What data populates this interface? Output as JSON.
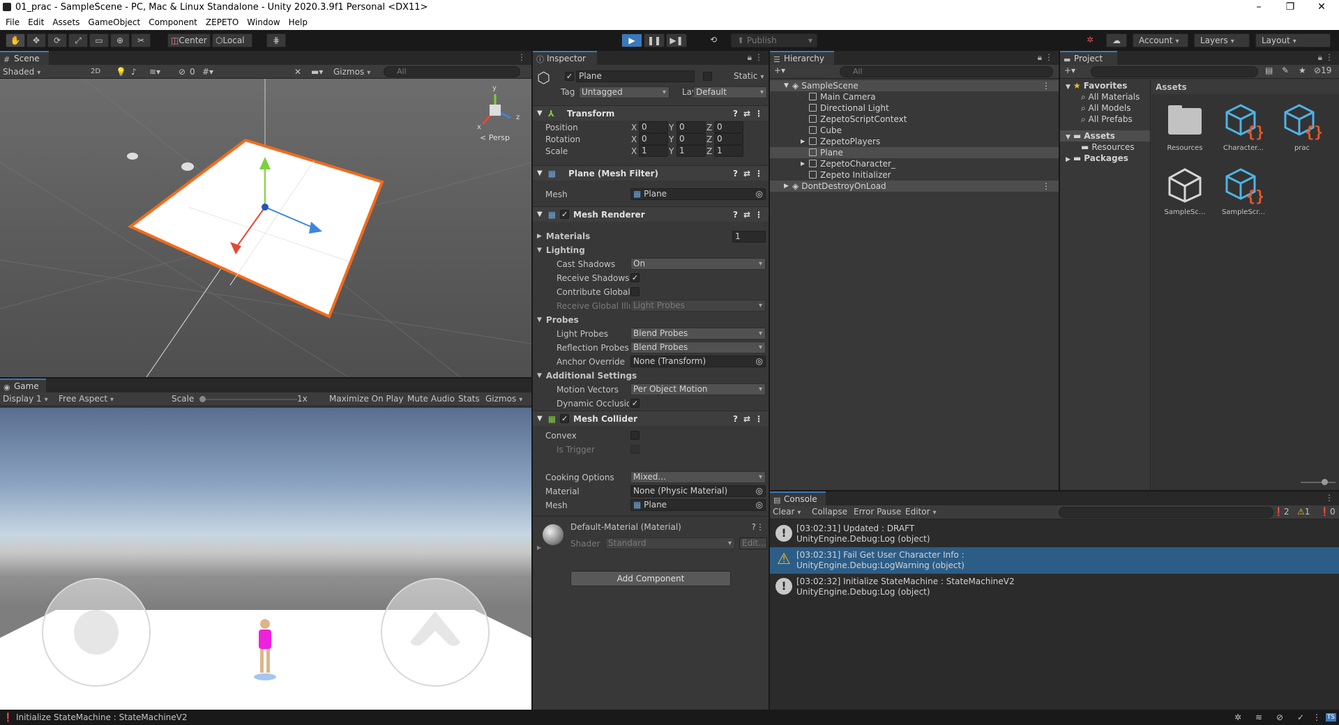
{
  "window": {
    "title": "01_prac - SampleScene - PC, Mac & Linux Standalone - Unity 2020.3.9f1 Personal <DX11>",
    "minimize": "–",
    "maximize": "❐",
    "close": "✕"
  },
  "menu": [
    "File",
    "Edit",
    "Assets",
    "GameObject",
    "Component",
    "ZEPETO",
    "Window",
    "Help"
  ],
  "toolbar": {
    "pivot": "Center",
    "space": "Local",
    "publish": "Publish",
    "account": "Account",
    "layers": "Layers",
    "layout": "Layout"
  },
  "scene": {
    "tab": "Scene",
    "shading": "Shaded",
    "mode2d": "2D",
    "hidden_count": "0",
    "gizmos": "Gizmos",
    "search_placeholder": "All",
    "persp": "Persp",
    "axis_y": "y",
    "axis_x": "x",
    "axis_z": "z"
  },
  "game": {
    "tab": "Game",
    "display": "Display 1",
    "aspect": "Free Aspect",
    "scale_label": "Scale",
    "scale_value": "1x",
    "maximize": "Maximize On Play",
    "mute": "Mute Audio",
    "stats": "Stats",
    "gizmos": "Gizmos"
  },
  "inspector": {
    "tab": "Inspector",
    "object_name": "Plane",
    "static": "Static",
    "tag_label": "Tag",
    "tag": "Untagged",
    "layer_label": "Layer",
    "layer": "Default",
    "transform": {
      "title": "Transform",
      "rows": [
        {
          "label": "Position",
          "x": "0",
          "y": "0",
          "z": "0"
        },
        {
          "label": "Rotation",
          "x": "0",
          "y": "0",
          "z": "0"
        },
        {
          "label": "Scale",
          "x": "1",
          "y": "1",
          "z": "1"
        }
      ]
    },
    "mesh_filter": {
      "title": "Plane (Mesh Filter)",
      "mesh_label": "Mesh",
      "mesh": "Plane"
    },
    "mesh_renderer": {
      "title": "Mesh Renderer",
      "materials_label": "Materials",
      "materials_count": "1",
      "lighting": "Lighting",
      "cast_shadows_label": "Cast Shadows",
      "cast_shadows": "On",
      "receive_shadows_label": "Receive Shadows",
      "contribute_gi_label": "Contribute Global I",
      "receive_gi_label": "Receive Global Illu",
      "receive_gi": "Light Probes",
      "probes": "Probes",
      "light_probes_label": "Light Probes",
      "light_probes": "Blend Probes",
      "reflection_probes_label": "Reflection Probes",
      "reflection_probes": "Blend Probes",
      "anchor_override_label": "Anchor Override",
      "anchor_override": "None (Transform)",
      "additional": "Additional Settings",
      "motion_vectors_label": "Motion Vectors",
      "motion_vectors": "Per Object Motion",
      "dynamic_occlusion_label": "Dynamic Occlusion"
    },
    "mesh_collider": {
      "title": "Mesh Collider",
      "convex_label": "Convex",
      "is_trigger_label": "Is Trigger",
      "cooking_label": "Cooking Options",
      "cooking": "Mixed...",
      "material_label": "Material",
      "material": "None (Physic Material)",
      "mesh_label": "Mesh",
      "mesh": "Plane"
    },
    "material": {
      "title": "Default-Material (Material)",
      "shader_label": "Shader",
      "shader": "Standard",
      "edit": "Edit..."
    },
    "add_component": "Add Component"
  },
  "hierarchy": {
    "tab": "Hierarchy",
    "search_placeholder": "All",
    "scene": "SampleScene",
    "items": [
      "Main Camera",
      "Directional Light",
      "ZepetoScriptContext",
      "Cube",
      "ZepetoPlayers",
      "Plane",
      "ZepetoCharacter_",
      "Zepeto Initializer"
    ],
    "dont_destroy": "DontDestroyOnLoad"
  },
  "project": {
    "tab": "Project",
    "hidden_count": "19",
    "favorites": "Favorites",
    "fav_items": [
      "All Materials",
      "All Models",
      "All Prefabs"
    ],
    "assets": "Assets",
    "resources": "Resources",
    "packages": "Packages",
    "breadcrumb": "Assets",
    "files": [
      {
        "name": "Resources",
        "icon": "folder-icon"
      },
      {
        "name": "Character...",
        "icon": "script-icon"
      },
      {
        "name": "prac",
        "icon": "script-icon"
      },
      {
        "name": "SampleSc...",
        "icon": "unity-scene-icon"
      },
      {
        "name": "SampleScr...",
        "icon": "script-icon"
      }
    ]
  },
  "console": {
    "tab": "Console",
    "clear": "Clear",
    "collapse": "Collapse",
    "error_pause": "Error Pause",
    "editor": "Editor",
    "info_count": "2",
    "warn_count": "1",
    "error_count": "0",
    "logs": [
      {
        "line1": "[03:02:31] Updated : DRAFT",
        "line2": "UnityEngine.Debug:Log (object)",
        "type": "info"
      },
      {
        "line1": "[03:02:31] Fail Get User Character Info :",
        "line2": "UnityEngine.Debug:LogWarning (object)",
        "type": "warning"
      },
      {
        "line1": "[03:02:32] Initialize StateMachine : StateMachineV2",
        "line2": "UnityEngine.Debug:Log (object)",
        "type": "info"
      }
    ]
  },
  "status": {
    "message": "Initialize StateMachine : StateMachineV2"
  },
  "colors": {
    "accent": "#3a79bb",
    "selection_outline": "#f26b1d",
    "warning": "#f0c020",
    "console_selected": "#2c5d87"
  }
}
